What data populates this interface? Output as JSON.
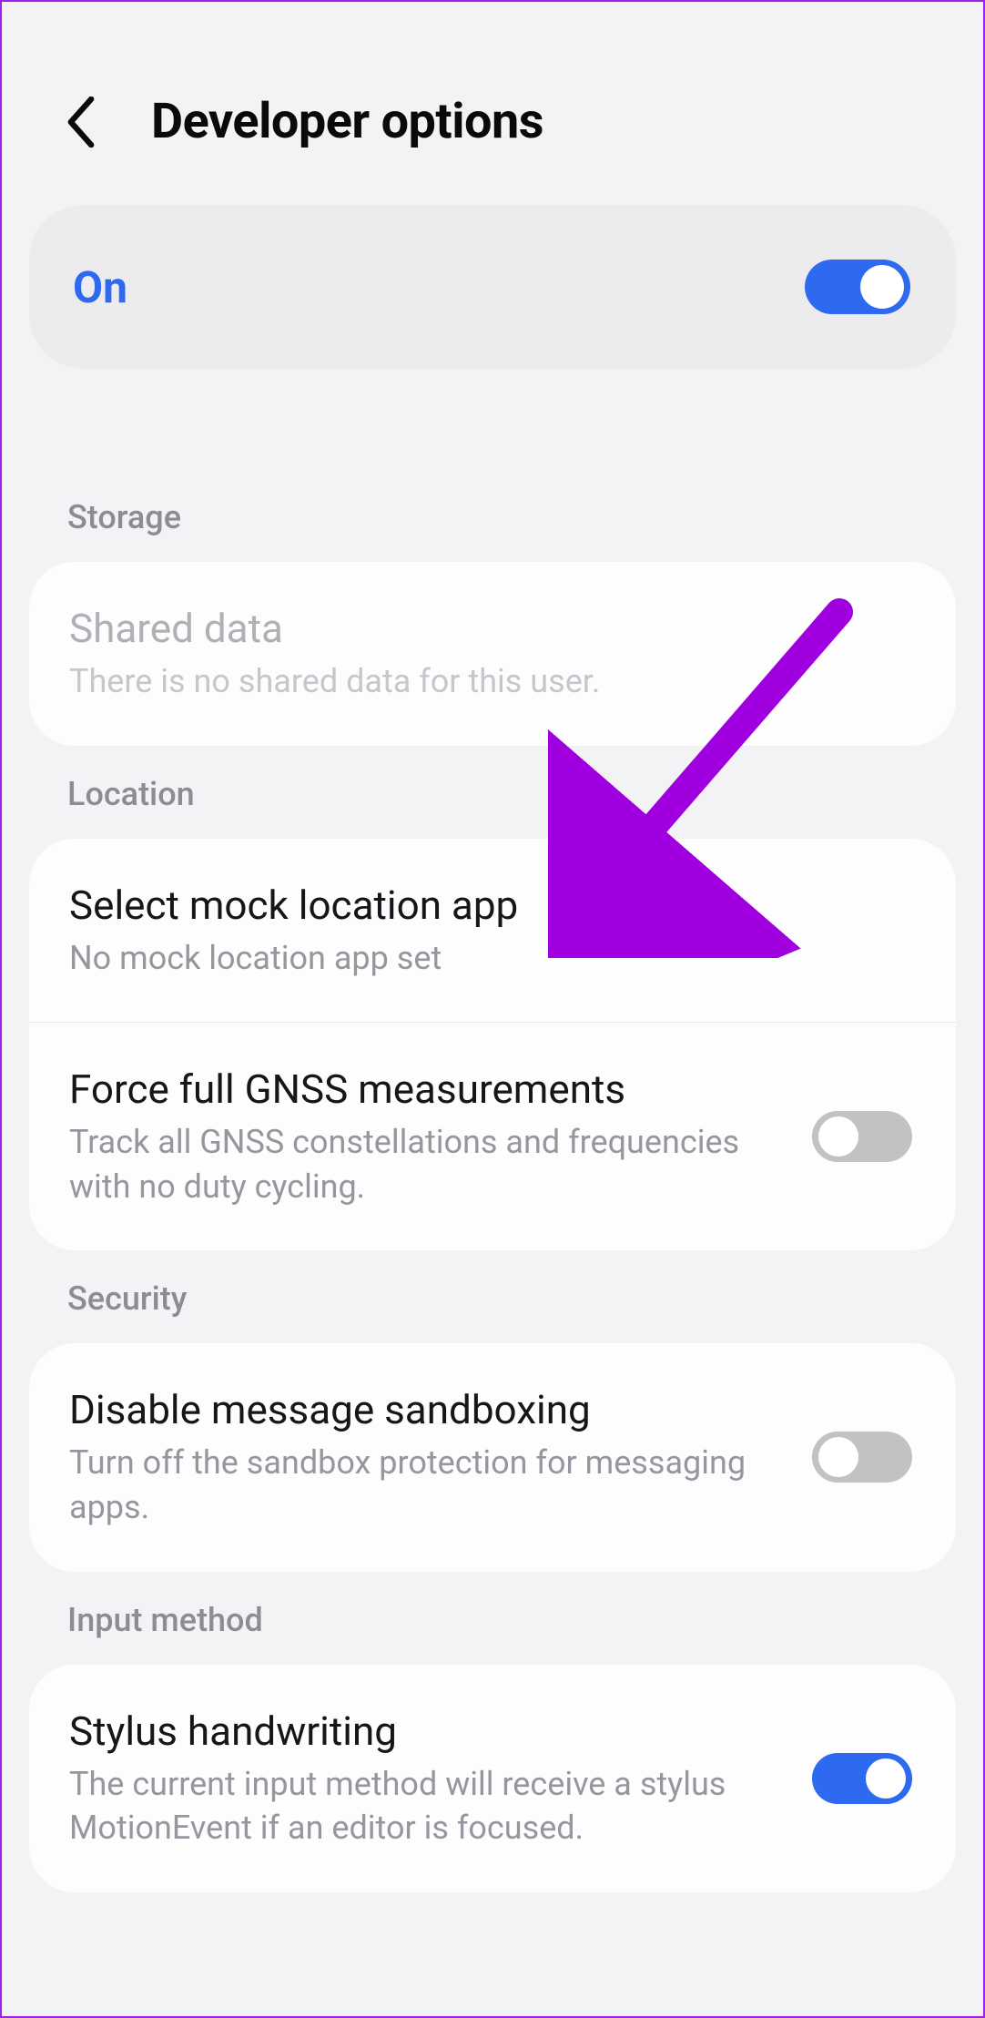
{
  "header": {
    "title": "Developer options"
  },
  "master": {
    "label": "On",
    "on": true
  },
  "sections": {
    "storage": {
      "header": "Storage",
      "shared_data": {
        "title": "Shared data",
        "sub": "There is no shared data for this user."
      }
    },
    "location": {
      "header": "Location",
      "mock": {
        "title": "Select mock location app",
        "sub": "No mock location app set"
      },
      "gnss": {
        "title": "Force full GNSS measurements",
        "sub": "Track all GNSS constellations and frequencies with no duty cycling.",
        "on": false
      }
    },
    "security": {
      "header": "Security",
      "sandbox": {
        "title": "Disable message sandboxing",
        "sub": "Turn off the sandbox protection for messaging apps.",
        "on": false
      }
    },
    "input": {
      "header": "Input method",
      "stylus": {
        "title": "Stylus handwriting",
        "sub": "The current input method will receive a stylus MotionEvent if an editor is focused.",
        "on": true
      }
    }
  }
}
